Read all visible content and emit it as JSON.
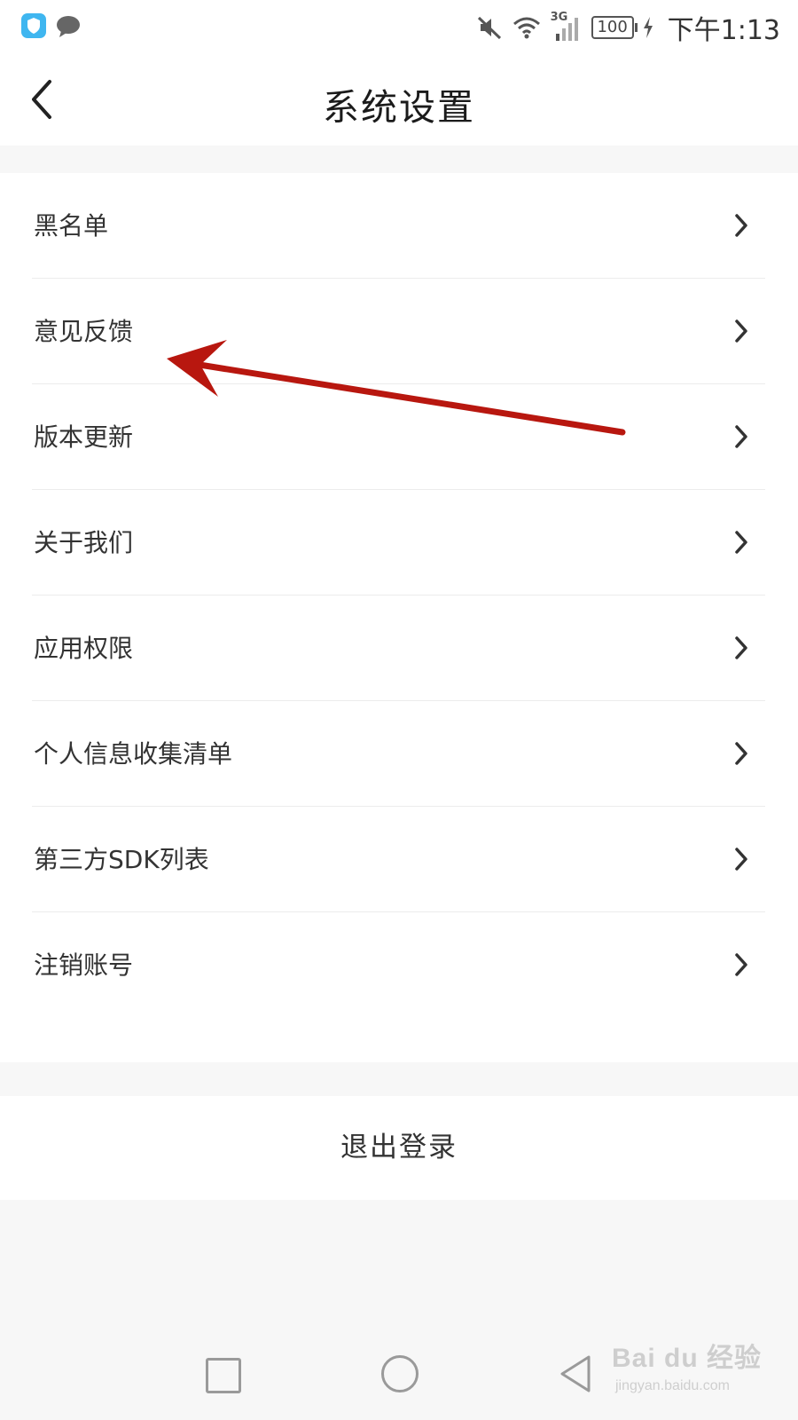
{
  "status_bar": {
    "time": "下午1:13",
    "battery": "100",
    "network": "3G",
    "icons": [
      "shield-app-icon",
      "chat-icon",
      "mute-icon",
      "wifi-icon",
      "signal-icon",
      "battery-icon",
      "charging-icon"
    ]
  },
  "header": {
    "title": "系统设置",
    "back_icon": "chevron-left-icon"
  },
  "settings": {
    "items": [
      {
        "label": "黑名单"
      },
      {
        "label": "意见反馈"
      },
      {
        "label": "版本更新"
      },
      {
        "label": "关于我们"
      },
      {
        "label": "应用权限"
      },
      {
        "label": "个人信息收集清单"
      },
      {
        "label": "第三方SDK列表"
      },
      {
        "label": "注销账号"
      }
    ]
  },
  "logout": {
    "label": "退出登录"
  },
  "annotation": {
    "color": "#b8170f"
  },
  "watermark": {
    "main": "Bai du 经验",
    "sub": "jingyan.baidu.com"
  }
}
